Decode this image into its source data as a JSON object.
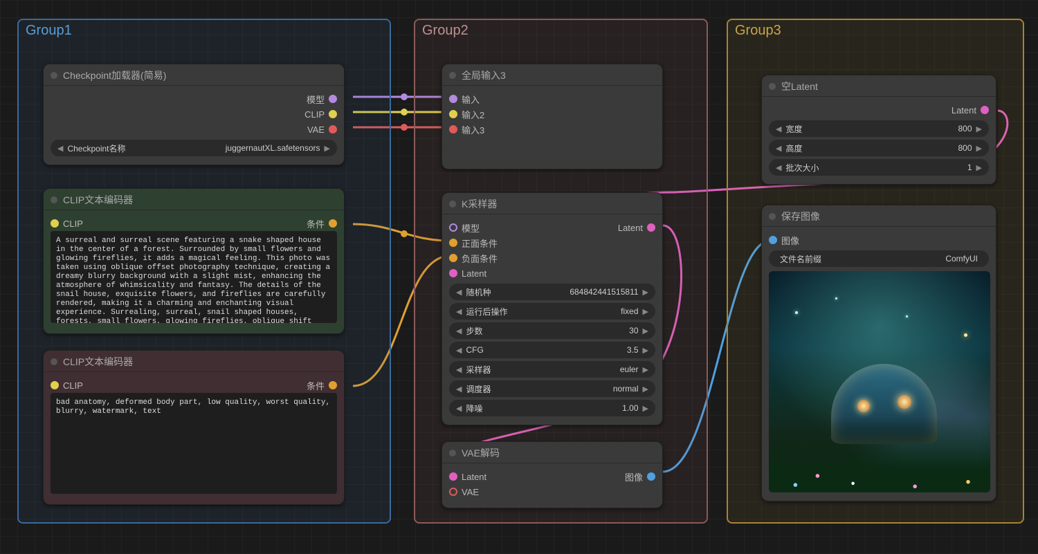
{
  "groups": {
    "g1": "Group1",
    "g2": "Group2",
    "g3": "Group3"
  },
  "checkpoint": {
    "title": "Checkpoint加载器(简易)",
    "out_model": "模型",
    "out_clip": "CLIP",
    "out_vae": "VAE",
    "widget_label": "Checkpoint名称",
    "widget_value": "juggernautXL.safetensors"
  },
  "global_input": {
    "title": "全局输入3",
    "in1": "输入",
    "in2": "输入2",
    "in3": "输入3"
  },
  "clip_pos": {
    "title": "CLIP文本编码器",
    "in_clip": "CLIP",
    "out_cond": "条件",
    "text": "A surreal and surreal scene featuring a snake shaped house in the center of a forest. Surrounded by small flowers and glowing fireflies, it adds a magical feeling. This photo was taken using oblique offset photography technique, creating a dreamy blurry background with a slight mist, enhancing the atmosphere of whimsicality and fantasy. The details of the snail house, exquisite flowers, and fireflies are carefully rendered, making it a charming and enchanting visual experience. Surrealing, surreal, snail shaped houses, forests, small flowers, glowing fireflies, oblique shift photography, dreamy, blurry backgrounds, light mist,"
  },
  "clip_neg": {
    "title": "CLIP文本编码器",
    "in_clip": "CLIP",
    "out_cond": "条件",
    "text": "bad anatomy, deformed body part, low quality, worst quality, blurry, watermark, text"
  },
  "ksampler": {
    "title": "K采样器",
    "in_model": "模型",
    "in_pos": "正面条件",
    "in_neg": "负面条件",
    "in_latent": "Latent",
    "out_latent": "Latent",
    "widgets": {
      "seed_label": "随机种",
      "seed_value": "684842441515811",
      "after_label": "运行后操作",
      "after_value": "fixed",
      "steps_label": "步数",
      "steps_value": "30",
      "cfg_label": "CFG",
      "cfg_value": "3.5",
      "sampler_label": "采样器",
      "sampler_value": "euler",
      "scheduler_label": "调度器",
      "scheduler_value": "normal",
      "denoise_label": "降噪",
      "denoise_value": "1.00"
    }
  },
  "empty_latent": {
    "title": "空Latent",
    "out_latent": "Latent",
    "width_label": "宽度",
    "width_value": "800",
    "height_label": "高度",
    "height_value": "800",
    "batch_label": "批次大小",
    "batch_value": "1"
  },
  "vae_decode": {
    "title": "VAE解码",
    "in_latent": "Latent",
    "in_vae": "VAE",
    "out_image": "图像"
  },
  "save_image": {
    "title": "保存图像",
    "in_image": "图像",
    "prefix_label": "文件名前缀",
    "prefix_value": "ComfyUI"
  },
  "colors": {
    "model": "#b28ae0",
    "clip": "#e0d050",
    "vae": "#e05a5a",
    "cond": "#e0a030",
    "latent": "#e060c0",
    "image": "#50a0e0"
  }
}
